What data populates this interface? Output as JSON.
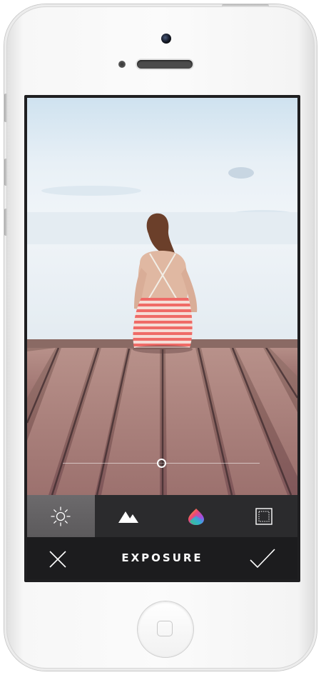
{
  "editor": {
    "title": "EXPOSURE",
    "adjustment_value": 0.5
  },
  "toolbar": {
    "tools": [
      {
        "name": "exposure",
        "icon": "sun-icon",
        "active": true
      },
      {
        "name": "contrast",
        "icon": "mountains-icon",
        "active": false
      },
      {
        "name": "color",
        "icon": "color-drop-icon",
        "active": false
      },
      {
        "name": "crop",
        "icon": "crop-frame-icon",
        "active": false
      }
    ]
  },
  "bottom_bar": {
    "cancel_icon": "close-icon",
    "confirm_icon": "checkmark-icon"
  },
  "colors": {
    "toolbar_bg": "#2b2b2d",
    "active_tool_bg": "#5f5d5f",
    "bottom_bar_bg": "#1c1c1e",
    "text": "#ffffff"
  }
}
